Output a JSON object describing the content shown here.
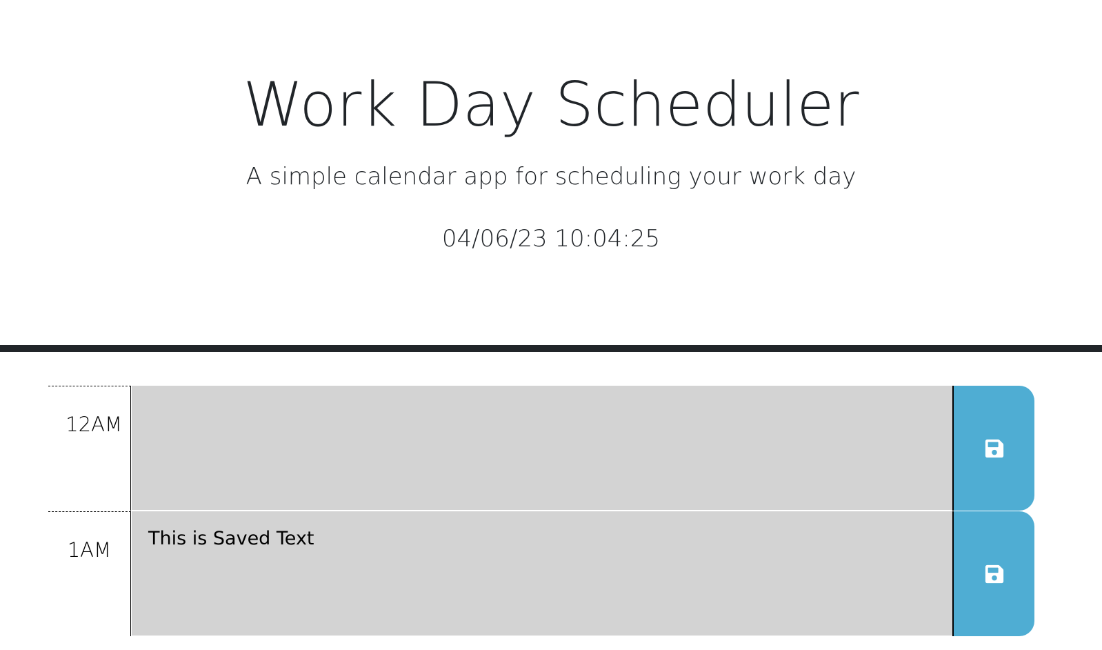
{
  "header": {
    "title": "Work Day Scheduler",
    "subtitle": "A simple calendar app for scheduling your work day",
    "current_datetime": "04/06/23 10:04:25"
  },
  "colors": {
    "past_block": "#d3d3d3",
    "save_button": "#4fadd3",
    "divider": "#212529"
  },
  "time_blocks": [
    {
      "hour_label": "12AM",
      "text": "",
      "save_icon": "floppy-disk-icon"
    },
    {
      "hour_label": "1AM",
      "text": "This is Saved Text",
      "save_icon": "floppy-disk-icon"
    }
  ]
}
